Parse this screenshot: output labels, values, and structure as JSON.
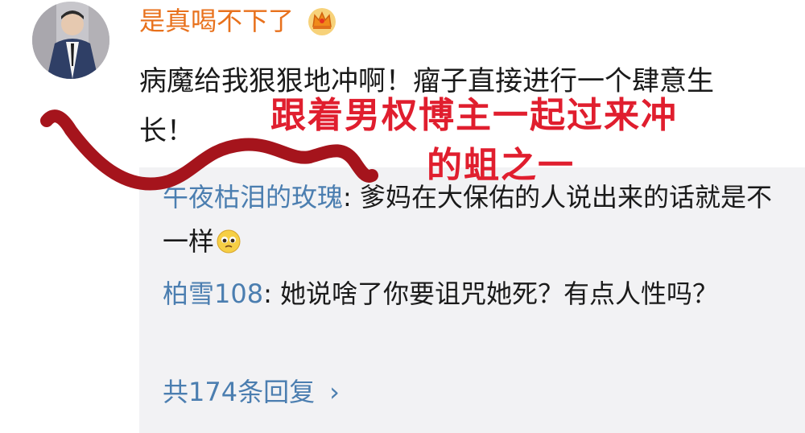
{
  "comment": {
    "username": "是真喝不下了",
    "text": "病魔给我狠狠地冲啊！瘤子直接进行一个肆意生长！"
  },
  "replies": [
    {
      "author": "午夜枯泪的玫瑰",
      "sep": ": ",
      "text": "爹妈在大保佑的人说出来的话就是不一样"
    },
    {
      "author": "柏雪108",
      "sep": ": ",
      "text": "她说啥了你要诅咒她死？有点人性吗？"
    }
  ],
  "reply_count": {
    "label": "共174条回复",
    "chevron": "›"
  },
  "annotation": {
    "line1": "跟着男权博主一起过来冲",
    "line2": "的蛆之一",
    "color": "#e01e2e"
  },
  "icons": {
    "badge": "crown-icon",
    "emoji": "pleading-face-icon"
  },
  "colors": {
    "username": "#e8711c",
    "link": "#4b7eb0",
    "reply_bg": "#f2f2f4",
    "squiggle": "#a5141c"
  }
}
